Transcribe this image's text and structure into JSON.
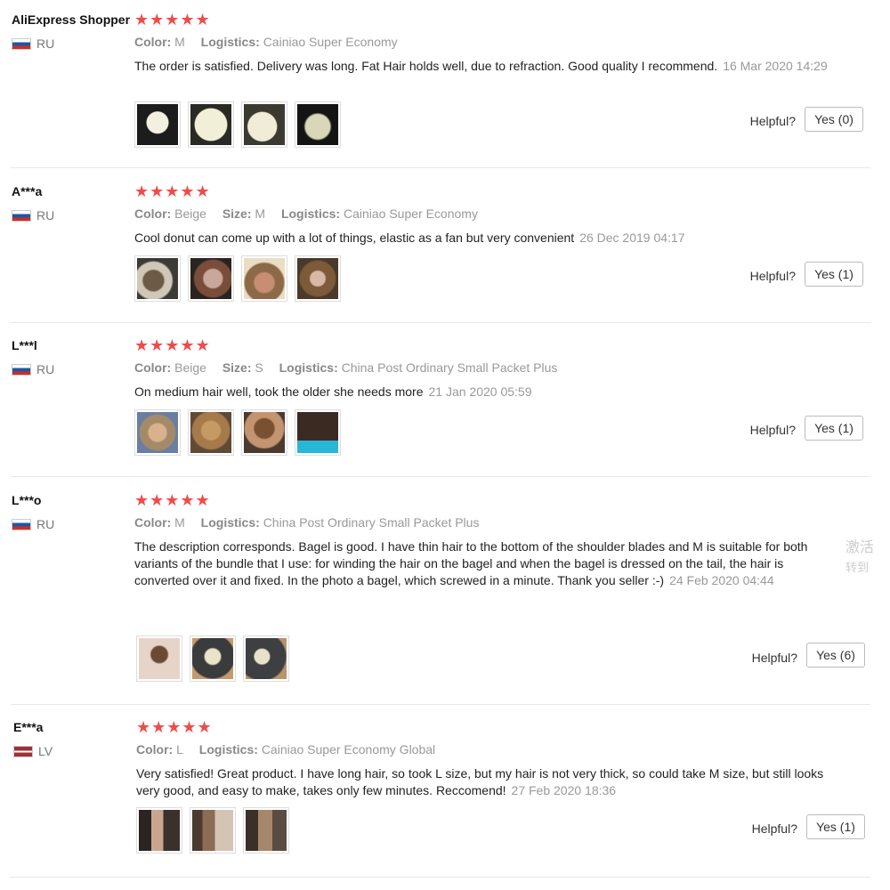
{
  "helpful_label": "Helpful?",
  "reviews": [
    {
      "user": "AliExpress Shopper",
      "country": "RU",
      "stars": "★★★★★",
      "meta": [
        {
          "label": "Color:",
          "value": "M"
        },
        {
          "label": "Logistics:",
          "value": "Cainiao Super Economy"
        }
      ],
      "text": "The order is satisfied. Delivery was long. Fat Hair holds well, due to refraction. Good quality I recommend.",
      "date": "16 Mar 2020 14:29",
      "yes": "Yes (0)"
    },
    {
      "user": "A***a",
      "country": "RU",
      "stars": "★★★★★",
      "meta": [
        {
          "label": "Color:",
          "value": "Beige"
        },
        {
          "label": "Size:",
          "value": "M"
        },
        {
          "label": "Logistics:",
          "value": "Cainiao Super Economy"
        }
      ],
      "text": "Cool donut can come up with a lot of things, elastic as a fan but very convenient",
      "date": "26 Dec 2019 04:17",
      "yes": "Yes (1)"
    },
    {
      "user": "L***l",
      "country": "RU",
      "stars": "★★★★★",
      "meta": [
        {
          "label": "Color:",
          "value": "Beige"
        },
        {
          "label": "Size:",
          "value": "S"
        },
        {
          "label": "Logistics:",
          "value": "China Post Ordinary Small Packet Plus"
        }
      ],
      "text": "On medium hair well, took the older she needs more",
      "date": "21 Jan 2020 05:59",
      "yes": "Yes (1)"
    },
    {
      "user": "L***o",
      "country": "RU",
      "stars": "★★★★★",
      "meta": [
        {
          "label": "Color:",
          "value": "M"
        },
        {
          "label": "Logistics:",
          "value": "China Post Ordinary Small Packet Plus"
        }
      ],
      "text": "The description corresponds. Bagel is good. I have thin hair to the bottom of the shoulder blades and M is suitable for both variants of the bundle that I use: for winding the hair on the bagel and when the bagel is dressed on the tail, the hair is converted over it and fixed. In the photo a bagel, which screwed in a minute. Thank you seller :-)",
      "date": "24 Feb 2020 04:44",
      "yes": "Yes (6)"
    },
    {
      "user": "E***a",
      "country": "LV",
      "stars": "★★★★★",
      "meta": [
        {
          "label": "Color:",
          "value": "L"
        },
        {
          "label": "Logistics:",
          "value": "Cainiao Super Economy Global"
        }
      ],
      "text": "Very satisfied! Great product. I have long hair, so took L size, but my hair is not very thick, so could take M size, but still looks very good, and easy to make, takes only few minutes. Reccomend!",
      "date": "27 Feb 2020 18:36",
      "yes": "Yes (1)"
    }
  ],
  "side_text": [
    "激活",
    "转到"
  ]
}
